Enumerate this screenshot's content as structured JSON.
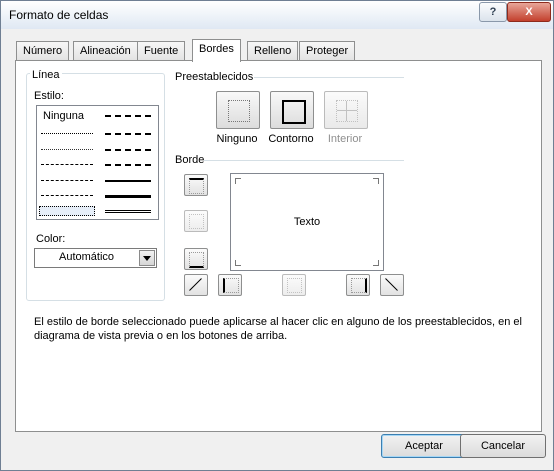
{
  "window": {
    "title": "Formato de celdas",
    "help": "?",
    "close": "X"
  },
  "tabs": [
    "Número",
    "Alineación",
    "Fuente",
    "Bordes",
    "Relleno",
    "Proteger"
  ],
  "line_group": {
    "title": "Línea",
    "style_label": "Estilo:",
    "none_label": "Ninguna",
    "color_label": "Color:",
    "color_value": "Automático"
  },
  "presets": {
    "title": "Preestablecidos",
    "items": [
      "Ninguno",
      "Contorno",
      "Interior"
    ]
  },
  "border": {
    "title": "Borde",
    "preview_text": "Texto"
  },
  "note": "El estilo de borde seleccionado puede aplicarse al hacer clic en alguno de los preestablecidos, en el diagrama de vista previa o en los botones de arriba.",
  "buttons": {
    "ok": "Aceptar",
    "cancel": "Cancelar"
  }
}
